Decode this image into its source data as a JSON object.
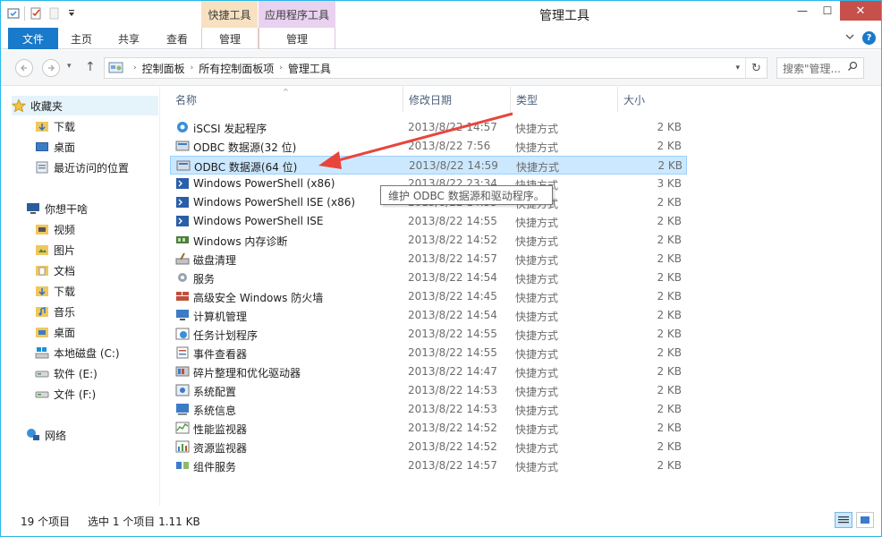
{
  "window": {
    "title": "管理工具",
    "context_tab_groups": [
      "快捷工具",
      "应用程序工具"
    ],
    "close_glyph": "✕",
    "minimize_glyph": "—",
    "maximize_glyph": "☐"
  },
  "ribbon": {
    "file": "文件",
    "tabs": [
      "主页",
      "共享",
      "查看",
      "管理",
      "管理"
    ],
    "help": "?"
  },
  "address": {
    "crumbs": [
      "控制面板",
      "所有控制面板项",
      "管理工具"
    ],
    "search_placeholder": "搜索\"管理...",
    "up_glyph": "↑",
    "refresh_glyph": "↻"
  },
  "nav": {
    "favorites_label": "收藏夹",
    "favorites": [
      "下载",
      "桌面",
      "最近访问的位置"
    ],
    "pc_label": "你想干啥",
    "pc_items": [
      "视频",
      "图片",
      "文档",
      "下载",
      "音乐",
      "桌面",
      "本地磁盘 (C:)",
      "软件 (E:)",
      "文件 (F:)"
    ],
    "network_label": "网络"
  },
  "columns": {
    "name": "名称",
    "date": "修改日期",
    "type": "类型",
    "size": "大小"
  },
  "files": [
    {
      "name": "iSCSI 发起程序",
      "date": "2013/8/22 14:57",
      "type": "快捷方式",
      "size": "2 KB",
      "icon": "iscsi-icon"
    },
    {
      "name": "ODBC 数据源(32 位)",
      "date": "2013/8/22 7:56",
      "type": "快捷方式",
      "size": "2 KB",
      "icon": "odbc-icon"
    },
    {
      "name": "ODBC 数据源(64 位)",
      "date": "2013/8/22 14:59",
      "type": "快捷方式",
      "size": "2 KB",
      "icon": "odbc-icon"
    },
    {
      "name": "Windows PowerShell (x86)",
      "date": "2013/8/22 23:34",
      "type": "快捷方式",
      "size": "3 KB",
      "icon": "powershell-icon"
    },
    {
      "name": "Windows PowerShell ISE (x86)",
      "date": "2013/8/22 14:55",
      "type": "快捷方式",
      "size": "2 KB",
      "icon": "powershell-icon"
    },
    {
      "name": "Windows PowerShell ISE",
      "date": "2013/8/22 14:55",
      "type": "快捷方式",
      "size": "2 KB",
      "icon": "powershell-icon"
    },
    {
      "name": "Windows 内存诊断",
      "date": "2013/8/22 14:52",
      "type": "快捷方式",
      "size": "2 KB",
      "icon": "memory-diagnostic-icon"
    },
    {
      "name": "磁盘清理",
      "date": "2013/8/22 14:57",
      "type": "快捷方式",
      "size": "2 KB",
      "icon": "disk-cleanup-icon"
    },
    {
      "name": "服务",
      "date": "2013/8/22 14:54",
      "type": "快捷方式",
      "size": "2 KB",
      "icon": "services-icon"
    },
    {
      "name": "高级安全 Windows 防火墙",
      "date": "2013/8/22 14:45",
      "type": "快捷方式",
      "size": "2 KB",
      "icon": "firewall-icon"
    },
    {
      "name": "计算机管理",
      "date": "2013/8/22 14:54",
      "type": "快捷方式",
      "size": "2 KB",
      "icon": "computer-management-icon"
    },
    {
      "name": "任务计划程序",
      "date": "2013/8/22 14:55",
      "type": "快捷方式",
      "size": "2 KB",
      "icon": "task-scheduler-icon"
    },
    {
      "name": "事件查看器",
      "date": "2013/8/22 14:55",
      "type": "快捷方式",
      "size": "2 KB",
      "icon": "event-viewer-icon"
    },
    {
      "name": "碎片整理和优化驱动器",
      "date": "2013/8/22 14:47",
      "type": "快捷方式",
      "size": "2 KB",
      "icon": "defrag-icon"
    },
    {
      "name": "系统配置",
      "date": "2013/8/22 14:53",
      "type": "快捷方式",
      "size": "2 KB",
      "icon": "system-config-icon"
    },
    {
      "name": "系统信息",
      "date": "2013/8/22 14:53",
      "type": "快捷方式",
      "size": "2 KB",
      "icon": "system-info-icon"
    },
    {
      "name": "性能监视器",
      "date": "2013/8/22 14:52",
      "type": "快捷方式",
      "size": "2 KB",
      "icon": "performance-monitor-icon"
    },
    {
      "name": "资源监视器",
      "date": "2013/8/22 14:52",
      "type": "快捷方式",
      "size": "2 KB",
      "icon": "resource-monitor-icon"
    },
    {
      "name": "组件服务",
      "date": "2013/8/22 14:57",
      "type": "快捷方式",
      "size": "2 KB",
      "icon": "component-services-icon"
    }
  ],
  "tooltip": "维护 ODBC 数据源和驱动程序。",
  "status": {
    "count": "19 个项目",
    "selection": "选中 1 个项目  1.11 KB"
  },
  "colors": {
    "accent": "#1979ca",
    "selection": "#cce8ff",
    "annotation_arrow": "#e8453c"
  }
}
